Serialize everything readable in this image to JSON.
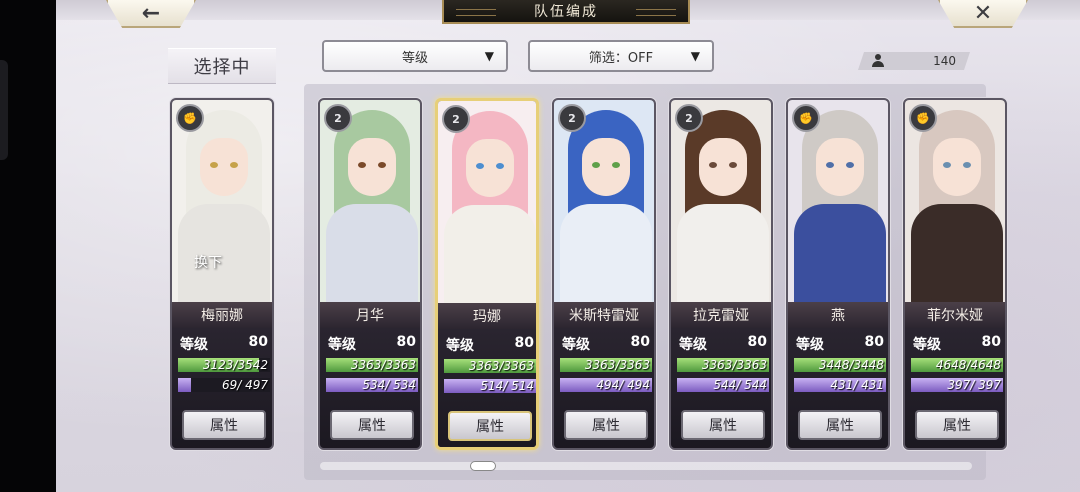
{
  "header": {
    "title": "队伍编成",
    "back_icon": "←",
    "close_icon": "✕"
  },
  "selecting_label": "选择中",
  "sort_dropdown": {
    "label": "等级",
    "arrow": "▼"
  },
  "filter_dropdown": {
    "label": "筛选：OFF",
    "arrow": "▼"
  },
  "count": {
    "value": "140"
  },
  "attr_label": "属性",
  "level_label": "等级",
  "selected_card": {
    "name": "梅丽娜",
    "level": "80",
    "hp_text": "3123/3542",
    "hp_frac": 0.88,
    "mp_text": "69/ 497",
    "mp_frac": 0.14,
    "swap_text": "换下",
    "colors": {
      "hair": "#ecebe4",
      "eye": "#c6a24a",
      "body": "#e6e4e0",
      "bg": "#f2f0ec"
    }
  },
  "cards": [
    {
      "name": "月华",
      "level": "80",
      "hp_text": "3363/3363",
      "hp_frac": 1.0,
      "mp_text": "534/ 534",
      "mp_frac": 1.0,
      "emblem": "2",
      "colors": {
        "hair": "#a8c9a0",
        "eye": "#7b4a2a",
        "body": "#d9dde8",
        "bg": "#e4ece2"
      }
    },
    {
      "name": "玛娜",
      "level": "80",
      "hp_text": "3363/3363",
      "hp_frac": 1.0,
      "mp_text": "514/ 514",
      "mp_frac": 1.0,
      "emblem": "2",
      "colors": {
        "hair": "#f4b7c3",
        "eye": "#4d8ed0",
        "body": "#f2efe9",
        "bg": "#f7eef0"
      }
    },
    {
      "name": "米斯特雷娅",
      "level": "80",
      "hp_text": "3363/3363",
      "hp_frac": 1.0,
      "mp_text": "494/ 494",
      "mp_frac": 1.0,
      "emblem": "2",
      "colors": {
        "hair": "#3a64c2",
        "eye": "#5fa04a",
        "body": "#e9eef6",
        "bg": "#dde7f4"
      }
    },
    {
      "name": "拉克雷娅",
      "level": "80",
      "hp_text": "3363/3363",
      "hp_frac": 1.0,
      "mp_text": "544/ 544",
      "mp_frac": 1.0,
      "emblem": "2",
      "colors": {
        "hair": "#5a3a28",
        "eye": "#6a4a3a",
        "body": "#f1efec",
        "bg": "#ece8e4"
      }
    },
    {
      "name": "燕",
      "level": "80",
      "hp_text": "3448/3448",
      "hp_frac": 1.0,
      "mp_text": "431/ 431",
      "mp_frac": 1.0,
      "emblem": "",
      "colors": {
        "hair": "#cfcac6",
        "eye": "#4f6fa8",
        "body": "#3b4f9e",
        "bg": "#e8e4ec"
      }
    },
    {
      "name": "菲尔米娅",
      "level": "80",
      "hp_text": "4648/4648",
      "hp_frac": 1.0,
      "mp_text": "397/ 397",
      "mp_frac": 1.0,
      "emblem": "",
      "colors": {
        "hair": "#d8c8c0",
        "eye": "#6a8fb0",
        "body": "#3a2c28",
        "bg": "#ece6e2"
      }
    }
  ],
  "scroll": {
    "position": 0.24
  }
}
